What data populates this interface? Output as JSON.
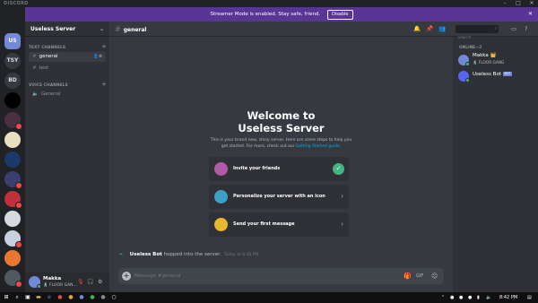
{
  "app": {
    "brand": "DISCORD"
  },
  "window": {
    "minimize": "–",
    "maximize": "□",
    "close": "✕"
  },
  "banner": {
    "text": "Streamer Mode is enabled. Stay safe, friend.",
    "button": "Disable",
    "close": "✕"
  },
  "servers": [
    {
      "label": "US",
      "active": true
    },
    {
      "label": "TSY"
    },
    {
      "label": "BD"
    }
  ],
  "sidebar": {
    "guild_name": "Useless Server",
    "chevron": "⌄",
    "text_category": "TEXT CHANNELS",
    "voice_category": "VOICE CHANNELS",
    "add": "+",
    "text_channels": [
      {
        "name": "general",
        "selected": true
      },
      {
        "name": "test"
      }
    ],
    "voice_channels": [
      {
        "name": "General"
      }
    ]
  },
  "user": {
    "name": "Makka",
    "status": "🕺 FLOOR GAN..."
  },
  "header": {
    "channel": "general"
  },
  "welcome": {
    "title_line1": "Welcome to",
    "title_line2": "Useless Server",
    "desc_part1": "This is your brand new, shiny server. Here are some steps to help you get started. For more, check out our ",
    "desc_link": "Getting Started guide.",
    "cards": [
      {
        "label": "Invite your friends",
        "done": true
      },
      {
        "label": "Personalize your server with an icon"
      },
      {
        "label": "Send your first message"
      }
    ],
    "check": "✓",
    "chevron": "›"
  },
  "system_message": {
    "who": "Useless Bot",
    "text": " hopped into the server.",
    "time": "Today at 8:38 PM"
  },
  "composer": {
    "placeholder": "Message #general",
    "plus": "+"
  },
  "members": {
    "search_placeholder": "Search",
    "heading": "ONLINE—2",
    "list": [
      {
        "name": "Makka 👑",
        "status": "🕺 FLOOR GANG",
        "color": "#7289da"
      },
      {
        "name": "Useless Bot",
        "badge": "BOT",
        "color": "#5865f2"
      }
    ]
  },
  "taskbar": {
    "clock": "8:42 PM"
  },
  "colors": {
    "blurple": "#7289da",
    "streamer": "#593695",
    "online": "#43b581",
    "notify": "#f04747"
  }
}
